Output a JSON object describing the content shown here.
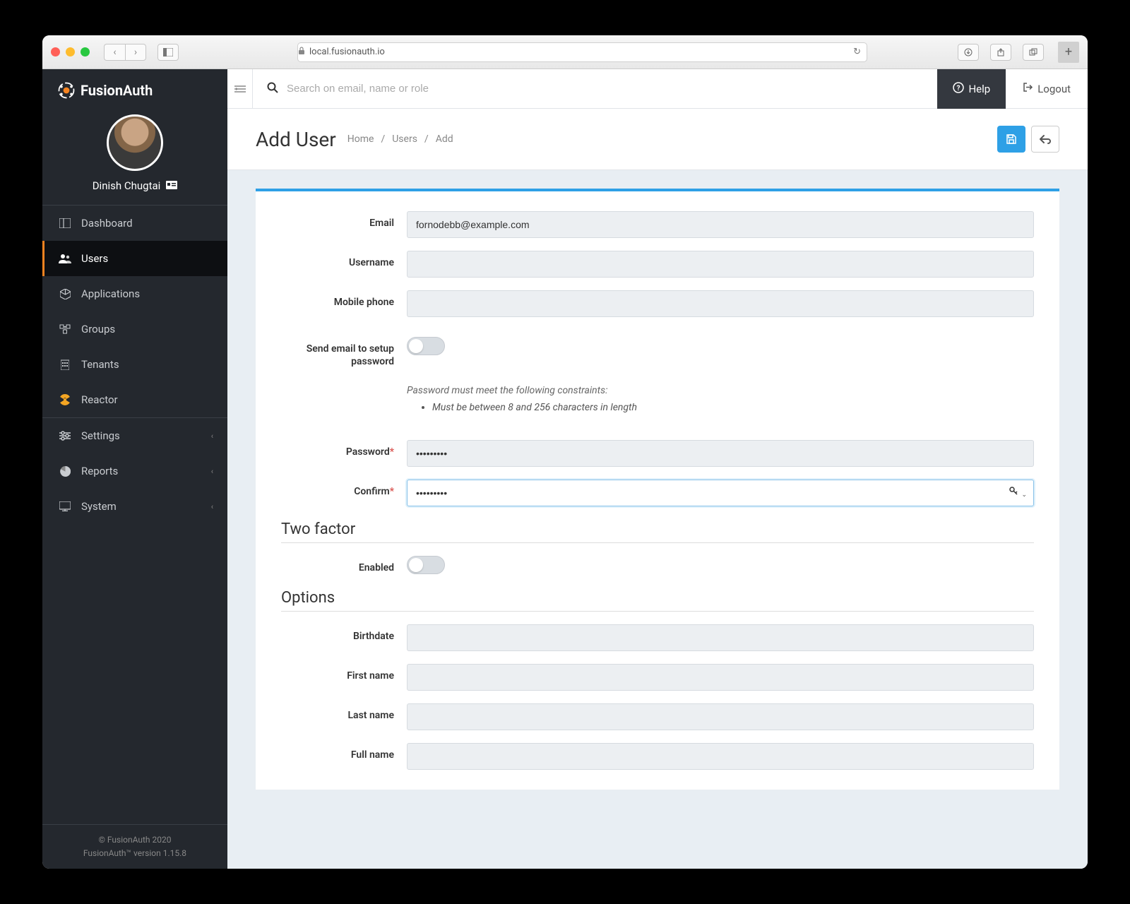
{
  "browser": {
    "url": "local.fusionauth.io"
  },
  "brand": {
    "name_a": "Fusion",
    "name_b": "Auth"
  },
  "profile": {
    "name": "Dinish Chugtai"
  },
  "sidebar": {
    "items": [
      {
        "label": "Dashboard"
      },
      {
        "label": "Users"
      },
      {
        "label": "Applications"
      },
      {
        "label": "Groups"
      },
      {
        "label": "Tenants"
      },
      {
        "label": "Reactor"
      },
      {
        "label": "Settings"
      },
      {
        "label": "Reports"
      },
      {
        "label": "System"
      }
    ]
  },
  "footer": {
    "copyright": "© FusionAuth 2020",
    "version": "FusionAuth™ version 1.15.8"
  },
  "topbar": {
    "search_placeholder": "Search on email, name or role",
    "help": "Help",
    "logout": "Logout"
  },
  "page": {
    "title": "Add User",
    "breadcrumb": [
      "Home",
      "Users",
      "Add"
    ]
  },
  "form": {
    "email_label": "Email",
    "email_value": "fornodebb@example.com",
    "username_label": "Username",
    "mobile_label": "Mobile phone",
    "send_email_label": "Send email to setup password",
    "password_hint": "Password must meet the following constraints:",
    "password_constraints": [
      "Must be between 8 and 256 characters in length"
    ],
    "password_label": "Password",
    "password_value": "•••••••••",
    "confirm_label": "Confirm",
    "confirm_value": "•••••••••",
    "two_factor_heading": "Two factor",
    "enabled_label": "Enabled",
    "options_heading": "Options",
    "birthdate_label": "Birthdate",
    "first_name_label": "First name",
    "last_name_label": "Last name",
    "full_name_label": "Full name"
  }
}
